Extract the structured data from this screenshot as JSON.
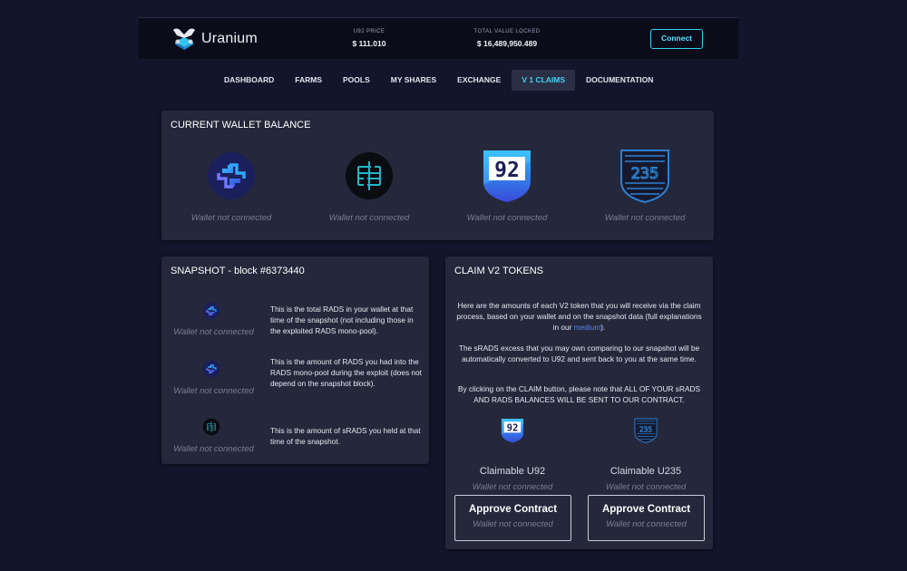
{
  "header": {
    "brand": "Uranium",
    "price_label": "U92 PRICE",
    "price_value": "$ 111.010",
    "tvl_label": "TOTAL VALUE LOCKED",
    "tvl_value": "$ 16,489,950.489",
    "connect_label": "Connect"
  },
  "nav": {
    "tabs": [
      "DASHBOARD",
      "FARMS",
      "POOLS",
      "MY SHARES",
      "EXCHANGE",
      "V 1 CLAIMS",
      "DOCUMENTATION"
    ],
    "active": "V 1 CLAIMS"
  },
  "balance": {
    "title": "CURRENT WALLET BALANCE",
    "items": [
      {
        "icon": "rads-coin-icon",
        "status": "Wallet not connected"
      },
      {
        "icon": "srads-coin-icon",
        "status": "Wallet not connected"
      },
      {
        "icon": "u92-shield-icon",
        "status": "Wallet not connected"
      },
      {
        "icon": "u235-shield-icon",
        "status": "Wallet not connected"
      }
    ]
  },
  "snapshot": {
    "title": "SNAPSHOT - block #6373440",
    "rows": [
      {
        "icon": "rads-coin-icon",
        "status": "Wallet not connected",
        "description": "This is the total RADS in your wallet at that time of the snapshot (not including those in the exploited RADS mono-pool)."
      },
      {
        "icon": "rads-coin-icon",
        "status": "Wallet not connected",
        "description": "This is the amount of RADS you had into the RADS mono-pool during the exploit (does not depend on the snapshot block)."
      },
      {
        "icon": "srads-coin-icon",
        "status": "Wallet not connected",
        "description": "This is the amount of sRADS you held at that time of the snapshot."
      }
    ]
  },
  "claim": {
    "title": "CLAIM V2 TOKENS",
    "para1": "Here are the amounts of each V2 token that you will receive via the claim process, based on your wallet and on the snapshot data (full explanations in our",
    "para1_link": "medium",
    "para1_end": ").",
    "para2": "The sRADS excess that you may own comparing to our snapshot will be automatically converted to U92 and sent back to you at the same time.",
    "para3": "By clicking on the CLAIM button, please note that ALL OF YOUR sRADS AND RADS BALANCES WILL BE SENT TO OUR CONTRACT.",
    "columns": [
      {
        "label": "Claimable U92",
        "status": "Wallet not connected",
        "button": "Approve Contract",
        "button_status": "Wallet not connected"
      },
      {
        "label": "Claimable U235",
        "status": "Wallet not connected",
        "button": "Approve Contract",
        "button_status": "Wallet not connected"
      }
    ]
  },
  "colors": {
    "background": "#13152a",
    "card": "#25283b",
    "accent": "#34d3f5",
    "link": "#4e88ff",
    "muted": "#7a7e94"
  }
}
